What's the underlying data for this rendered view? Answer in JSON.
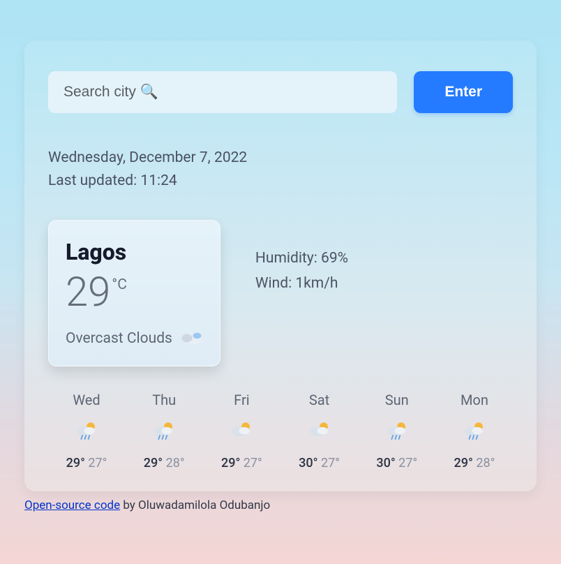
{
  "search": {
    "placeholder": "Search city 🔍",
    "value": "",
    "button_label": "Enter"
  },
  "meta": {
    "date_line": "Wednesday, December 7, 2022",
    "updated_line": "Last updated: 11:24"
  },
  "current": {
    "city": "Lagos",
    "temp": "29",
    "unit": "°C",
    "condition": "Overcast Clouds",
    "icon": "part-cloud"
  },
  "details": {
    "humidity_label": "Humidity: 69%",
    "wind_label": "Wind: 1km/h"
  },
  "forecast": [
    {
      "day": "Wed",
      "icon": "sun-cloud-rain",
      "hi": "29°",
      "lo": "27°"
    },
    {
      "day": "Thu",
      "icon": "sun-cloud-rain",
      "hi": "29°",
      "lo": "28°"
    },
    {
      "day": "Fri",
      "icon": "sun-cloud",
      "hi": "29°",
      "lo": "27°"
    },
    {
      "day": "Sat",
      "icon": "sun-cloud",
      "hi": "30°",
      "lo": "27°"
    },
    {
      "day": "Sun",
      "icon": "sun-cloud-rain",
      "hi": "30°",
      "lo": "27°"
    },
    {
      "day": "Mon",
      "icon": "sun-cloud-rain",
      "hi": "29°",
      "lo": "28°"
    }
  ],
  "footer": {
    "link_text": "Open-source code",
    "suffix": " by Oluwadamilola Odubanjo"
  }
}
